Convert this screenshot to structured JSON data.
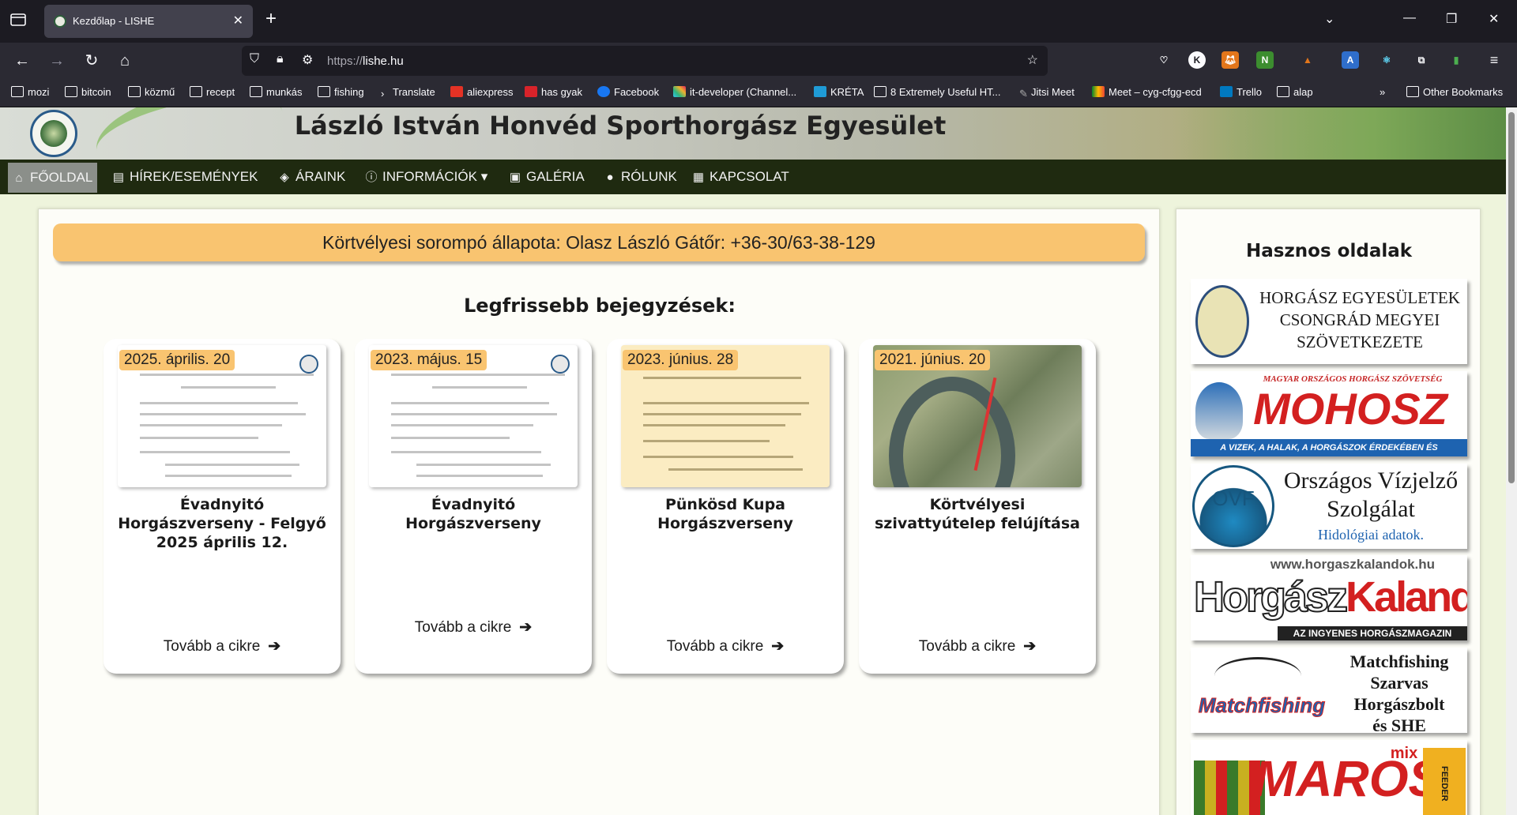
{
  "browser": {
    "tab_title": "Kezdőlap - LISHE",
    "url_proto": "https://",
    "url_host": "lishe.hu",
    "bookmarks": [
      "mozi",
      "bitcoin",
      "közmű",
      "recept",
      "munkás",
      "fishing",
      "Translate",
      "aliexpress",
      "has gyak",
      "Facebook",
      "it-developer (Channel...",
      "KRÉTA",
      "8 Extremely Useful HT...",
      "Jitsi Meet",
      "Meet – cyg-cfgg-ecd",
      "Trello",
      "alap"
    ],
    "other_bookmarks": "Other Bookmarks"
  },
  "site": {
    "title": "László István Honvéd Sporthorgász Egyesület",
    "nav": [
      "FŐOLDAL",
      "HÍREK/ESEMÉNYEK",
      "ÁRAINK",
      "INFORMÁCIÓK",
      "GALÉRIA",
      "RÓLUNK",
      "KAPCSOLAT"
    ]
  },
  "notice": "Körtvélyesi sorompó állapota: Olasz László Gátőr: +36-30/63-38-129",
  "latest_heading": "Legfrissebb bejegyzések:",
  "posts": [
    {
      "date": "2025. április. 20",
      "title": "Évadnyitó Horgászverseny - Felgyő 2025 április 12.",
      "more": "Tovább a cikre"
    },
    {
      "date": "2023. május. 15",
      "title": "Évadnyitó Horgászverseny",
      "more": "Tovább a cikre"
    },
    {
      "date": "2023. június. 28",
      "title": "Pünkösd Kupa Horgászverseny",
      "more": "Tovább a cikre"
    },
    {
      "date": "2021. június. 20",
      "title": "Körtvélyesi szivattyútelep felújítása",
      "more": "Tovább a cikre"
    }
  ],
  "sidebar": {
    "title": "Hasznos oldalak",
    "links": [
      {
        "line1": "HORGÁSZ EGYESÜLETEK",
        "line2": "CSONGRÁD MEGYEI",
        "line3": "SZÖVETKEZETE"
      },
      {
        "top": "MAGYAR ORSZÁGOS HORGÁSZ SZÖVETSÉG",
        "name": "MOHOSZ",
        "bottom": "A VIZEK, A HALAK, A HORGÁSZOK ÉRDEKÉBEN ÉS VÉDELMÉBEN!"
      },
      {
        "logo": "OVF",
        "line1": "Országos Vízjelző",
        "line2": "Szolgálat",
        "sub": "Hidológiai adatok."
      },
      {
        "url": "www.horgaszkalandok.hu",
        "name1": "Horgász",
        "name2": "Kalandok",
        "bottom": "AZ INGYENES HORGÁSZMAGAZIN"
      },
      {
        "logo": "Matchfishing",
        "line1": "Matchfishing",
        "line2": "Szarvas",
        "line3": "Horgászbolt",
        "line4": "és SHE"
      },
      {
        "name": "MAROS",
        "mix": "mix",
        "tag": "FEEDER"
      }
    ]
  }
}
